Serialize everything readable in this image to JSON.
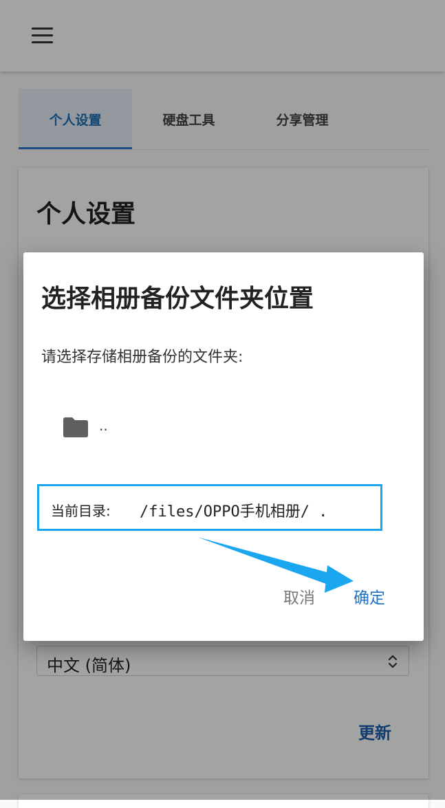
{
  "background": {
    "tabs": [
      {
        "label": "个人设置",
        "active": true
      },
      {
        "label": "硬盘工具",
        "active": false
      },
      {
        "label": "分享管理",
        "active": false
      }
    ],
    "card_title": "个人设置",
    "language_select": {
      "value": "中文 (简体)"
    },
    "update_label": "更新"
  },
  "dialog": {
    "title": "选择相册备份文件夹位置",
    "message": "请选择存储相册备份的文件夹:",
    "folder": {
      "icon": "folder-icon",
      "name": ".."
    },
    "current_dir_label": "当前目录:",
    "current_dir_path": "/files/OPPO手机相册/ .",
    "cancel_label": "取消",
    "ok_label": "确定"
  },
  "annotation": {
    "highlight_color": "#1aa7f0",
    "arrow_color": "#1aa7f0"
  }
}
